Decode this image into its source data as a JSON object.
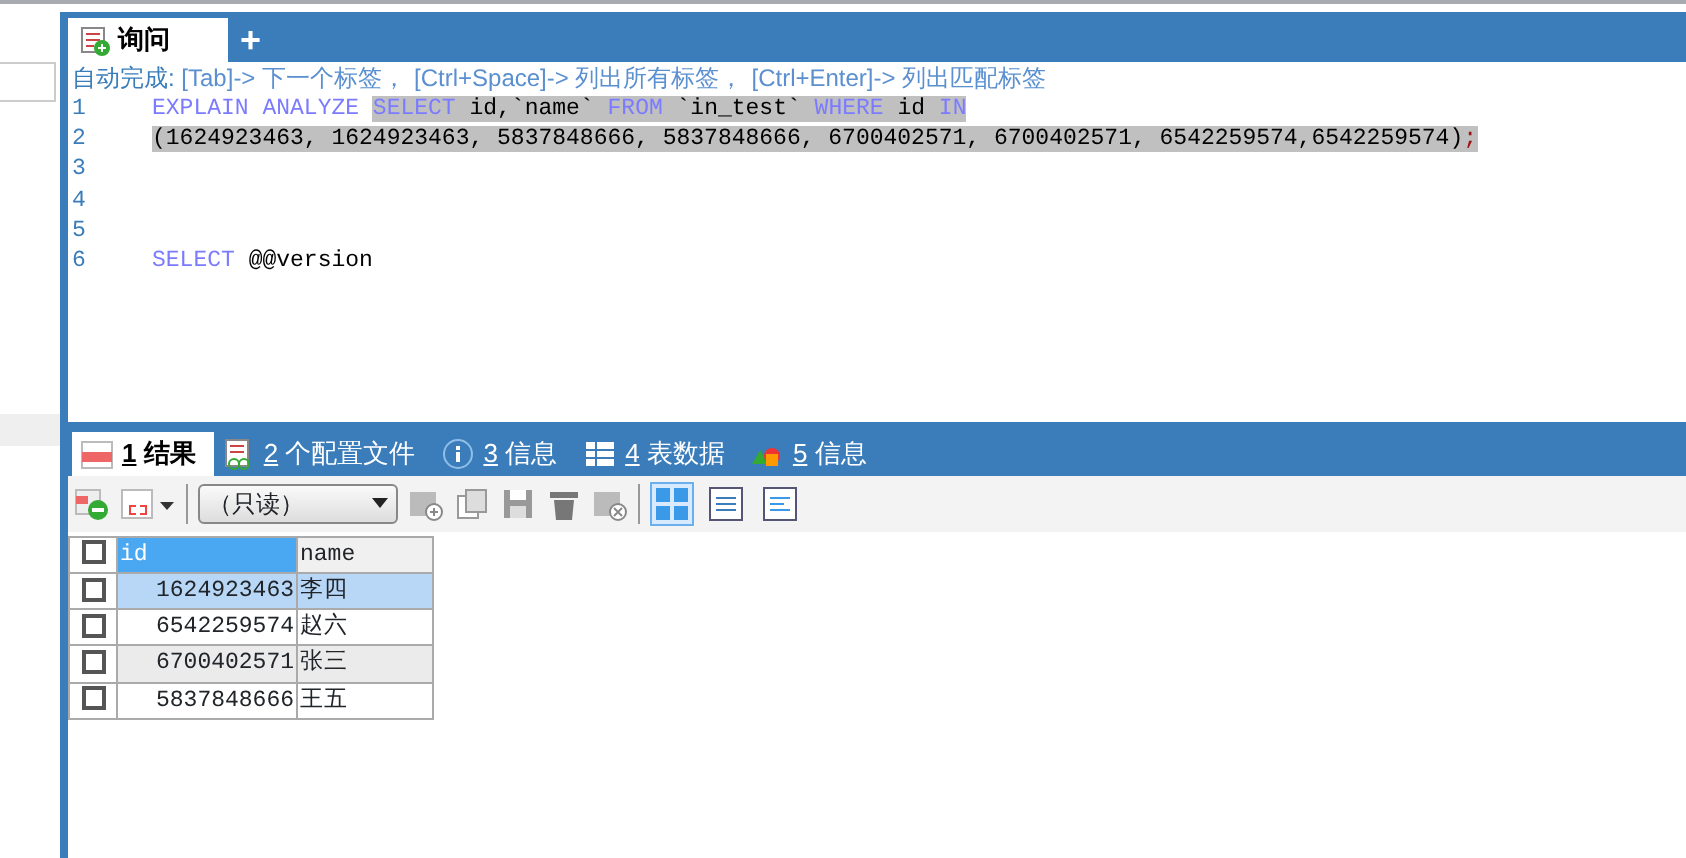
{
  "editor_tabs": [
    {
      "label": "询问",
      "kind": "query",
      "selected": true
    },
    {
      "label": "+",
      "kind": "add",
      "selected": false
    }
  ],
  "autocomplete_hint": [
    {
      "text": "自动完成: ",
      "kind": "label"
    },
    {
      "text": "[Tab]-> 下一个标签，",
      "kind": "hint"
    },
    {
      "text": "[Ctrl+Space]-> 列出所有标签，",
      "kind": "hint"
    },
    {
      "text": "[Ctrl+Enter]-> 列出匹配标签",
      "kind": "hint"
    }
  ],
  "code_lines": [
    {
      "number": "1",
      "segments": [
        {
          "text": "EXPLAIN ANALYZE ",
          "kind": "keyword",
          "selected": false
        },
        {
          "text": "SELECT",
          "kind": "keyword",
          "selected": true
        },
        {
          "text": " id,`name` ",
          "kind": "plain",
          "selected": true
        },
        {
          "text": "FROM",
          "kind": "keyword",
          "selected": true
        },
        {
          "text": " `in_test` ",
          "kind": "plain",
          "selected": true
        },
        {
          "text": "WHERE",
          "kind": "keyword",
          "selected": true
        },
        {
          "text": " id ",
          "kind": "plain",
          "selected": true
        },
        {
          "text": "IN",
          "kind": "keyword",
          "selected": true
        }
      ]
    },
    {
      "number": "2",
      "segments": [
        {
          "text": "(1624923463, 1624923463, 5837848666, 5837848666, 6700402571, 6700402571, 6542259574,6542259574)",
          "kind": "plain",
          "selected": true
        },
        {
          "text": ";",
          "kind": "punct",
          "selected": true
        }
      ]
    },
    {
      "number": "3"
    },
    {
      "number": "4"
    },
    {
      "number": "5"
    },
    {
      "number": "6",
      "segments": [
        {
          "text": "SELECT",
          "kind": "keyword",
          "selected": false
        },
        {
          "text": " @@version",
          "kind": "plain",
          "selected": false
        }
      ]
    }
  ],
  "result_tabs": [
    {
      "key": "1",
      "label": "结果",
      "selected": true
    },
    {
      "key": "2",
      "label": "个配置文件",
      "selected": false
    },
    {
      "key": "3",
      "label": "信息",
      "selected": false
    },
    {
      "key": "4",
      "label": "表数据",
      "selected": false
    },
    {
      "key": "5",
      "label": "信息",
      "selected": false
    }
  ],
  "toolbar": {
    "mode_select": "（只读）",
    "views": [
      {
        "selected": true
      },
      {
        "selected": false
      },
      {
        "selected": false
      }
    ]
  },
  "result_table": {
    "all_checked": false,
    "columns": [
      {
        "label": "id",
        "selected": true
      },
      {
        "label": "name",
        "selected": false
      }
    ],
    "rows": [
      {
        "cells": [
          "1624923463",
          "李四"
        ],
        "selected": true,
        "checked": false
      },
      {
        "cells": [
          "6542259574",
          "赵六"
        ],
        "selected": false,
        "checked": false
      },
      {
        "cells": [
          "6700402571",
          "张三"
        ],
        "selected": false,
        "checked": false
      },
      {
        "cells": [
          "5837848666",
          "王五"
        ],
        "selected": false,
        "checked": false
      }
    ]
  }
}
